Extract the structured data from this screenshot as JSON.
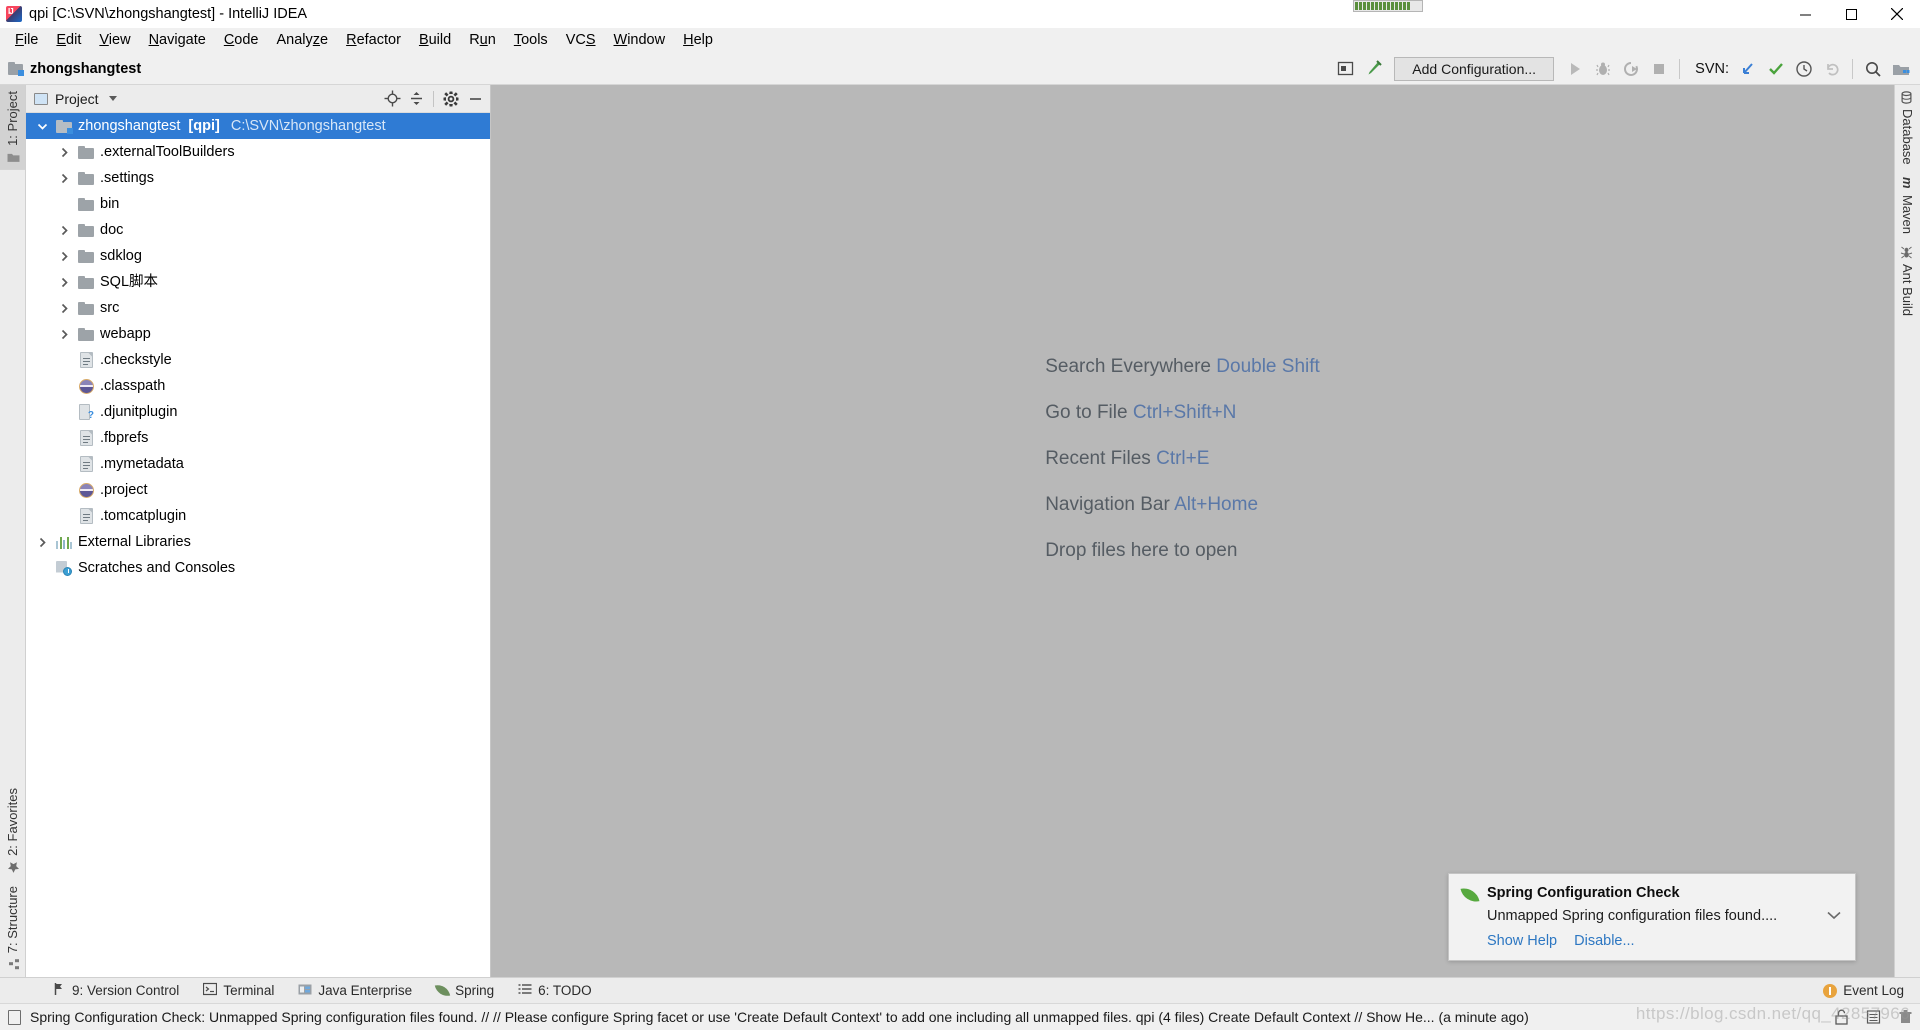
{
  "window": {
    "title": "qpi [C:\\SVN\\zhongshangtest] - IntelliJ IDEA",
    "app_icon": "intellij-idea-icon",
    "minimize": "—",
    "maximize": "□",
    "close": "✕"
  },
  "menubar": {
    "items": [
      {
        "label": "File",
        "mnemonic": "F"
      },
      {
        "label": "Edit",
        "mnemonic": "E"
      },
      {
        "label": "View",
        "mnemonic": "V"
      },
      {
        "label": "Navigate",
        "mnemonic": "N"
      },
      {
        "label": "Code",
        "mnemonic": "C"
      },
      {
        "label": "Analyze",
        "mnemonic": "z"
      },
      {
        "label": "Refactor",
        "mnemonic": "R"
      },
      {
        "label": "Build",
        "mnemonic": "B"
      },
      {
        "label": "Run",
        "mnemonic": "u"
      },
      {
        "label": "Tools",
        "mnemonic": "T"
      },
      {
        "label": "VCS",
        "mnemonic": "S"
      },
      {
        "label": "Window",
        "mnemonic": "W"
      },
      {
        "label": "Help",
        "mnemonic": "H"
      }
    ]
  },
  "toolbar": {
    "breadcrumb": "zhongshangtest",
    "run_configuration": "Add Configuration...",
    "svn_label": "SVN:",
    "buttons": [
      "project-structure-icon",
      "build-hammer-icon",
      "run-icon",
      "debug-icon",
      "run-with-coverage-icon",
      "stop-icon",
      "svn-update-icon",
      "svn-commit-icon",
      "svn-history-icon",
      "svn-rollback-icon",
      "search-everywhere-icon",
      "project-view-icon"
    ]
  },
  "left_stripe": {
    "top": [
      {
        "label": "1: Project",
        "icon": "project-icon",
        "active": true
      }
    ],
    "bottom": [
      {
        "label": "2: Favorites",
        "icon": "star-icon"
      },
      {
        "label": "7: Structure",
        "icon": "structure-icon"
      }
    ]
  },
  "right_stripe": {
    "items": [
      {
        "label": "Database",
        "icon": "database-icon"
      },
      {
        "label": "Maven",
        "icon": "maven-m-icon"
      },
      {
        "label": "Ant Build",
        "icon": "ant-icon"
      }
    ]
  },
  "project_panel": {
    "title": "Project",
    "actions": [
      "locate-target-icon",
      "collapse-all-icon",
      "settings-gear-icon",
      "hide-minimize-icon"
    ],
    "tree": [
      {
        "label": "zhongshangtest",
        "bold_suffix": "[qpi]",
        "path": "C:\\SVN\\zhongshangtest",
        "icon": "module-folder-icon",
        "indent": 0,
        "arrow": "expanded",
        "selected": true
      },
      {
        "label": ".externalToolBuilders",
        "icon": "folder-icon",
        "indent": 1,
        "arrow": "collapsed"
      },
      {
        "label": ".settings",
        "icon": "folder-icon",
        "indent": 1,
        "arrow": "collapsed"
      },
      {
        "label": "bin",
        "icon": "folder-icon",
        "indent": 1,
        "arrow": "none"
      },
      {
        "label": "doc",
        "icon": "folder-icon",
        "indent": 1,
        "arrow": "collapsed"
      },
      {
        "label": "sdklog",
        "icon": "folder-icon",
        "indent": 1,
        "arrow": "collapsed"
      },
      {
        "label": "SQL脚本",
        "icon": "folder-icon",
        "indent": 1,
        "arrow": "collapsed"
      },
      {
        "label": "src",
        "icon": "folder-icon",
        "indent": 1,
        "arrow": "collapsed"
      },
      {
        "label": "webapp",
        "icon": "folder-icon",
        "indent": 1,
        "arrow": "collapsed"
      },
      {
        "label": ".checkstyle",
        "icon": "xml-file-icon",
        "indent": 1,
        "arrow": "none"
      },
      {
        "label": ".classpath",
        "icon": "eclipse-file-icon",
        "indent": 1,
        "arrow": "none"
      },
      {
        "label": ".djunitplugin",
        "icon": "unknown-file-icon",
        "indent": 1,
        "arrow": "none"
      },
      {
        "label": ".fbprefs",
        "icon": "xml-file-icon",
        "indent": 1,
        "arrow": "none"
      },
      {
        "label": ".mymetadata",
        "icon": "xml-file-icon",
        "indent": 1,
        "arrow": "none"
      },
      {
        "label": ".project",
        "icon": "eclipse-file-icon",
        "indent": 1,
        "arrow": "none"
      },
      {
        "label": ".tomcatplugin",
        "icon": "xml-file-icon",
        "indent": 1,
        "arrow": "none"
      },
      {
        "label": "External Libraries",
        "icon": "libraries-icon",
        "indent": 0,
        "arrow": "collapsed"
      },
      {
        "label": "Scratches and Consoles",
        "icon": "scratches-icon",
        "indent": 0,
        "arrow": "none"
      }
    ]
  },
  "editor": {
    "hints": [
      {
        "action": "Search Everywhere",
        "shortcut": "Double Shift"
      },
      {
        "action": "Go to File",
        "shortcut": "Ctrl+Shift+N"
      },
      {
        "action": "Recent Files",
        "shortcut": "Ctrl+E"
      },
      {
        "action": "Navigation Bar",
        "shortcut": "Alt+Home"
      },
      {
        "action": "Drop files here to open",
        "shortcut": ""
      }
    ]
  },
  "notification": {
    "icon": "spring-leaf-icon",
    "title": "Spring Configuration Check",
    "text": "Unmapped Spring configuration files found....",
    "links": [
      "Show Help",
      "Disable..."
    ],
    "expand_icon": "chevron-down-icon"
  },
  "bottom_stripe": {
    "items": [
      {
        "label": "9: Version Control",
        "mnemonic": "9",
        "icon": "version-control-icon"
      },
      {
        "label": "Terminal",
        "mnemonic": "",
        "icon": "terminal-icon"
      },
      {
        "label": "Java Enterprise",
        "mnemonic": "",
        "icon": "java-enterprise-icon"
      },
      {
        "label": "Spring",
        "mnemonic": "",
        "icon": "spring-leaf-icon"
      },
      {
        "label": "6: TODO",
        "mnemonic": "6",
        "icon": "todo-list-icon"
      }
    ],
    "event_log": "Event Log"
  },
  "statusbar": {
    "icon": "status-document-icon",
    "message": "Spring Configuration Check: Unmapped Spring configuration files found. // // Please configure Spring facet or use 'Create Default Context' to add one including all unmapped files. qpi (4 files)   Create Default Context // Show He... (a minute ago)",
    "right_icons": [
      "unlock-icon",
      "line-separator-icon",
      "memory-trash-icon"
    ],
    "watermark": "https://blog.csdn.net/qq_42857966"
  }
}
